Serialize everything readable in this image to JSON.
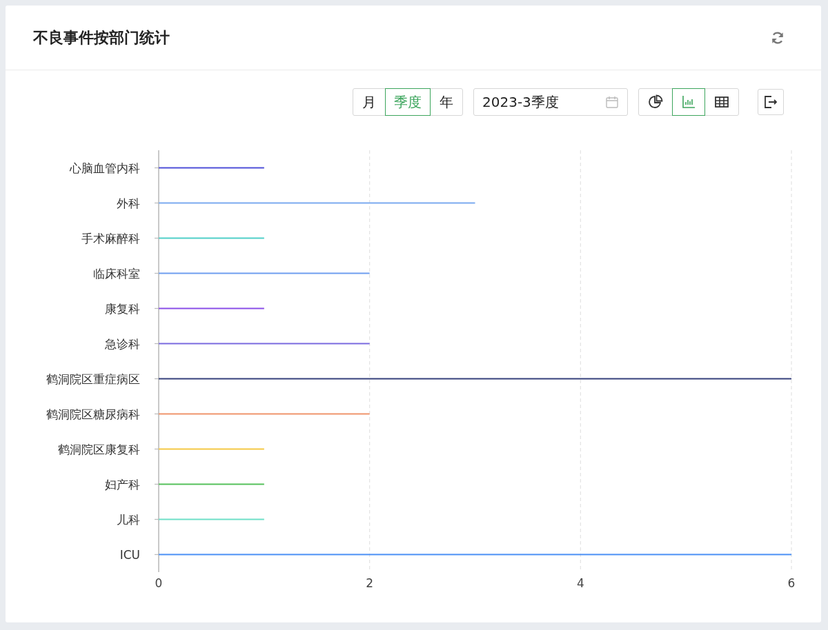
{
  "card": {
    "title": "不良事件按部门统计"
  },
  "period_tabs": [
    {
      "label": "月",
      "selected": false
    },
    {
      "label": "季度",
      "selected": true
    },
    {
      "label": "年",
      "selected": false
    }
  ],
  "date_field": {
    "value": "2023-3季度"
  },
  "view_tabs": [
    {
      "kind": "pie",
      "selected": false
    },
    {
      "kind": "bar",
      "selected": true
    },
    {
      "kind": "table",
      "selected": false
    }
  ],
  "chart_data": {
    "type": "bar",
    "orientation": "horizontal",
    "categories": [
      "心脑血管内科",
      "外科",
      "手术麻醉科",
      "临床科室",
      "康复科",
      "急诊科",
      "鹤洞院区重症病区",
      "鹤洞院区糖尿病科",
      "鹤洞院区康复科",
      "妇产科",
      "儿科",
      "ICU"
    ],
    "series": [
      {
        "values": [
          1,
          3,
          1,
          2,
          1,
          2,
          6,
          2,
          1,
          1,
          1,
          6
        ],
        "colors": [
          "#4e4fd8",
          "#7aaaf0",
          "#4fcfc8",
          "#6e9ef0",
          "#8a4fe8",
          "#7a6ae0",
          "#34407a",
          "#f0936a",
          "#f5c842",
          "#55c05a",
          "#6ee0c8",
          "#4a90f5"
        ]
      }
    ],
    "xlim": [
      0,
      6
    ],
    "xticks": [
      0,
      2,
      4,
      6
    ]
  }
}
